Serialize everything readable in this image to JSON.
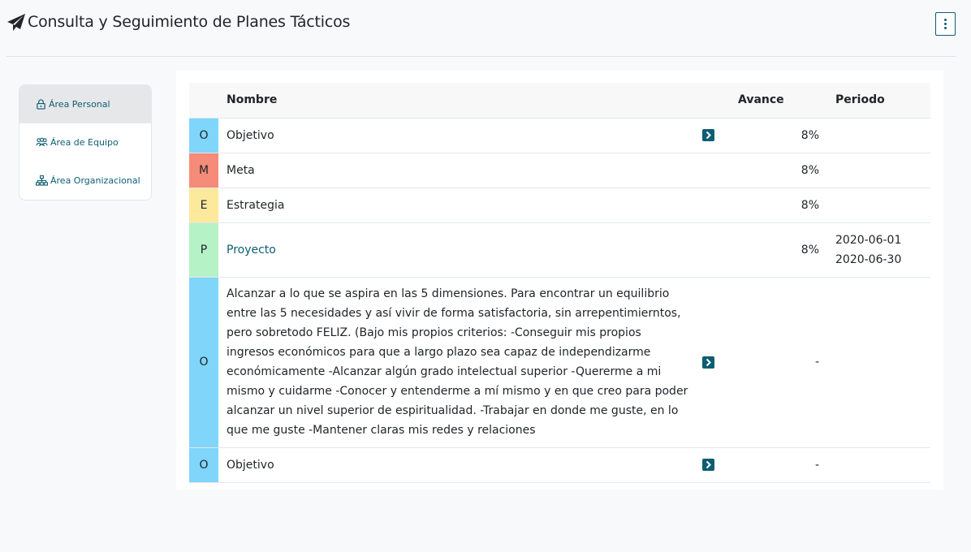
{
  "header": {
    "title": "Consulta y Seguimiento de Planes Tácticos",
    "icon": "paper-plane-icon",
    "menu_icon": "vertical-ellipsis-icon"
  },
  "sidebar": {
    "items": [
      {
        "label": "Área Personal",
        "icon": "lock-icon",
        "active": true
      },
      {
        "label": "Área de Equipo",
        "icon": "users-icon",
        "active": false
      },
      {
        "label": "Área Organizacional",
        "icon": "sitemap-icon",
        "active": false
      }
    ]
  },
  "table": {
    "headers": {
      "type": "",
      "name": "Nombre",
      "avance": "Avance",
      "periodo": "Periodo"
    },
    "rows": [
      {
        "type": "O",
        "name": "Objetivo",
        "has_arrow": true,
        "avance": "8%",
        "periodo_start": "",
        "periodo_end": ""
      },
      {
        "type": "M",
        "name": "Meta",
        "has_arrow": false,
        "avance": "8%",
        "periodo_start": "",
        "periodo_end": ""
      },
      {
        "type": "E",
        "name": "Estrategia",
        "has_arrow": false,
        "avance": "8%",
        "periodo_start": "",
        "periodo_end": ""
      },
      {
        "type": "P",
        "name": "Proyecto",
        "has_arrow": false,
        "avance": "8%",
        "periodo_start": "2020-06-01",
        "periodo_end": "2020-06-30"
      },
      {
        "type": "O",
        "name": "Alcanzar a lo que se aspira en las 5 dimensiones. Para encontrar un equilibrio entre las 5 necesidades y así vivir de forma satisfactoria, sin arrepentimierntos, pero sobretodo FELIZ. (Bajo mis propios criterios: -Conseguir mis propios ingresos económicos para que a largo plazo sea capaz de independizarme económicamente -Alcanzar algún grado intelectual superior -Quererme a mi mismo y cuidarme -Conocer y entenderme a mí mismo y en que creo para poder alcanzar un nivel superior de espiritualidad. -Trabajar en donde me guste, en lo que me guste -Mantener claras mis redes y relaciones",
        "has_arrow": true,
        "avance": "-",
        "periodo_start": "",
        "periodo_end": ""
      },
      {
        "type": "O",
        "name": "Objetivo",
        "has_arrow": true,
        "avance": "-",
        "periodo_start": "",
        "periodo_end": ""
      }
    ]
  },
  "colors": {
    "accent": "#0d5d73",
    "type_O": "#7fd5fa",
    "type_M": "#f58b78",
    "type_E": "#fce99b",
    "type_P": "#b5f3c6"
  }
}
